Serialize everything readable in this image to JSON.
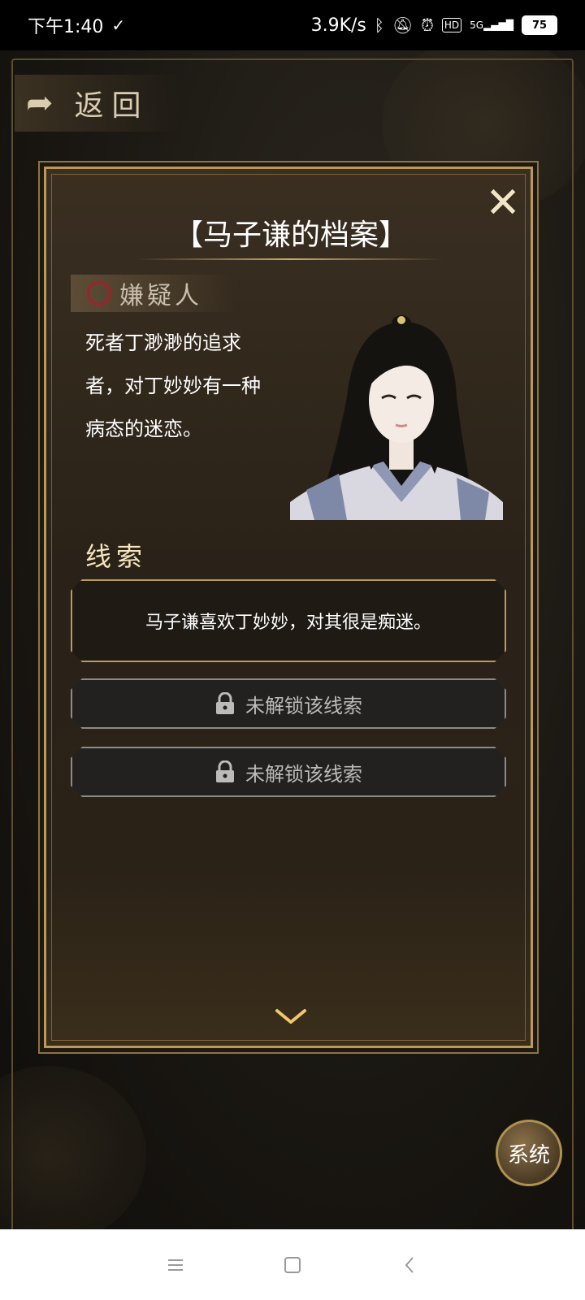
{
  "status_bar": {
    "time": "下午1:40",
    "network_speed": "3.9K/s",
    "battery": "75",
    "network_type": "5G",
    "icons": [
      "bluetooth-icon",
      "mute-bell-icon",
      "alarm-icon",
      "hd-icon",
      "signal-icon",
      "battery-icon"
    ]
  },
  "header": {
    "back_label": "返回"
  },
  "dialog": {
    "title": "【马子谦的档案】",
    "role": "嫌疑人",
    "description": "死者丁渺渺的追求者，对丁妙妙有一种病态的迷恋。",
    "section_title": "线索",
    "clues": [
      {
        "text": "马子谦喜欢丁妙妙，对其很是痴迷。",
        "locked": false
      },
      {
        "text": "未解锁该线索",
        "locked": true
      },
      {
        "text": "未解锁该线索",
        "locked": true
      }
    ]
  },
  "system_button_label": "系统",
  "colors": {
    "accent_gold": "#b99a5b",
    "role_ring": "#a3202a",
    "dialog_bg": "#2a2218"
  }
}
